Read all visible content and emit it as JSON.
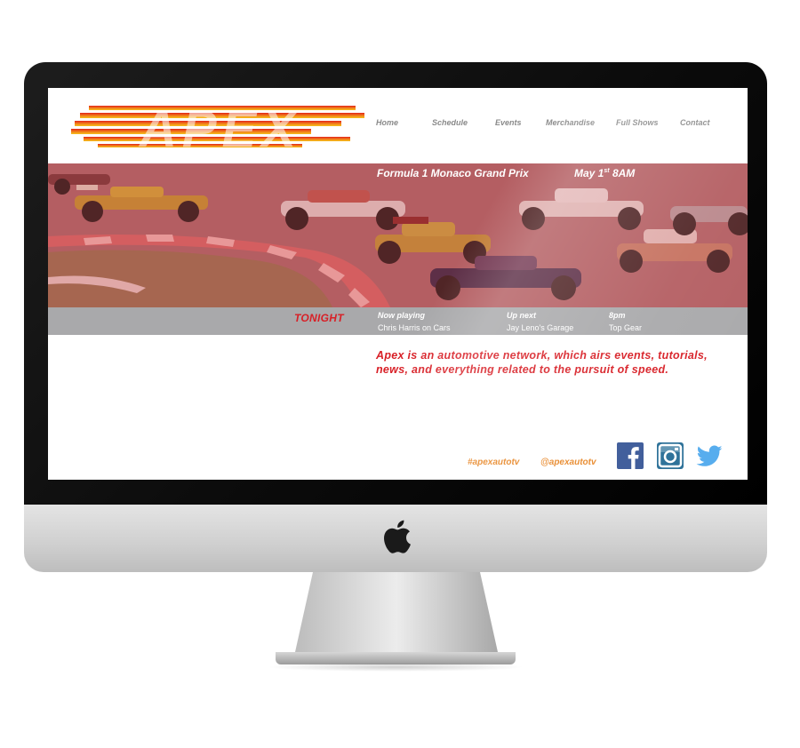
{
  "site": {
    "logo_text": "APEX",
    "nav": [
      "Home",
      "Schedule",
      "Events",
      "Merchandise",
      "Full Shows",
      "Contact"
    ]
  },
  "hero": {
    "event_title": "Formula 1 Monaco Grand Prix",
    "event_date_prefix": "May 1",
    "event_date_suffix": "st",
    "event_time": "8AM"
  },
  "schedule": {
    "label": "TONIGHT",
    "slots": [
      {
        "heading": "Now playing",
        "show": "Chris Harris on Cars"
      },
      {
        "heading": "Up next",
        "show": "Jay Leno's Garage"
      },
      {
        "heading": "8pm",
        "show": "Top Gear"
      }
    ]
  },
  "about": "Apex is an automotive network, which airs events, tutorials, news, and everything related to the pursuit of speed.",
  "footer": {
    "hashtag": "#apexautotv",
    "handle": "@apexautotv",
    "social": [
      "facebook-icon",
      "instagram-icon",
      "twitter-icon"
    ]
  },
  "colors": {
    "accent_red": "#d81f26",
    "accent_orange": "#e8892b",
    "schedule_bar": "#a9a9ab",
    "facebook_blue": "#3b5998",
    "instagram_blue": "#2a6f97",
    "twitter_blue": "#55acee"
  }
}
